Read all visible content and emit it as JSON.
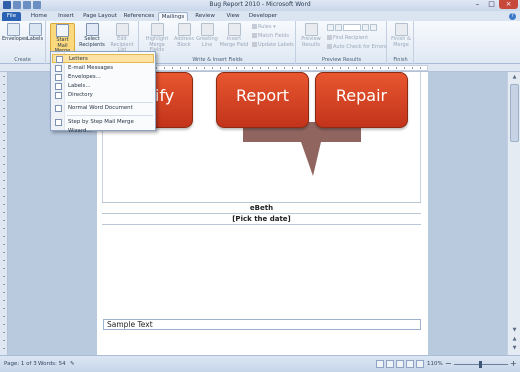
{
  "window": {
    "title": "Bug Report 2010 - Microsoft Word"
  },
  "tabs": [
    {
      "label": "File"
    },
    {
      "label": "Home"
    },
    {
      "label": "Insert"
    },
    {
      "label": "Page Layout"
    },
    {
      "label": "References"
    },
    {
      "label": "Mailings"
    },
    {
      "label": "Review"
    },
    {
      "label": "View"
    },
    {
      "label": "Developer"
    }
  ],
  "ribbon": {
    "create": {
      "label": "Create",
      "envelopes": "Envelopes",
      "labels": "Labels"
    },
    "start": {
      "start_mail_merge": "Start Mail Merge",
      "select_recipients": "Select Recipients",
      "edit_recipient_list": "Edit Recipient List"
    },
    "write": {
      "label": "Write & Insert Fields",
      "highlight": "Highlight Merge Fields",
      "address_block": "Address Block",
      "greeting_line": "Greeting Line",
      "insert_merge_field": "Insert Merge Field",
      "rules": "Rules",
      "match_fields": "Match Fields",
      "update_labels": "Update Labels"
    },
    "preview": {
      "label": "Preview Results",
      "preview_results": "Preview Results",
      "find_recipient": "Find Recipient",
      "auto_check": "Auto Check for Errors"
    },
    "finish": {
      "label": "Finish",
      "finish_merge": "Finish & Merge"
    }
  },
  "menu": {
    "items": [
      {
        "label": "Letters"
      },
      {
        "label": "E-mail Messages"
      },
      {
        "label": "Envelopes..."
      },
      {
        "label": "Labels..."
      },
      {
        "label": "Directory"
      },
      {
        "label": "Normal Word Document"
      },
      {
        "label": "Step by Step Mail Merge Wizard..."
      }
    ]
  },
  "document": {
    "smartart": [
      "entify",
      "Report",
      "Repair"
    ],
    "author": "eBeth",
    "date_placeholder": "[Pick the date]",
    "sample_text": "Sample Text"
  },
  "status": {
    "page": "Page: 1 of 3",
    "words": "Words: 54",
    "zoom": "110%"
  }
}
